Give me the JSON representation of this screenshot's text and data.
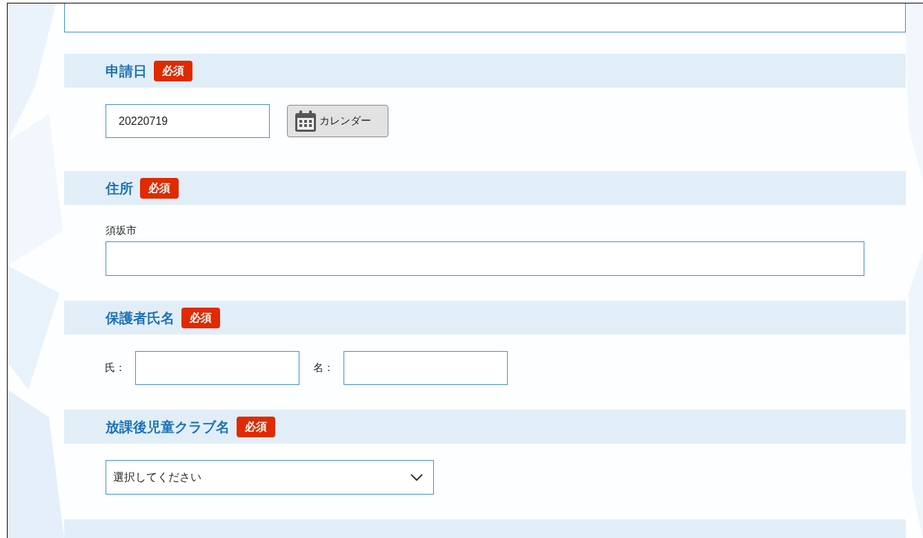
{
  "sections": [
    {
      "kind": "date",
      "title": "申請日",
      "badge": "必須",
      "value": "20220719",
      "button": "カレンダー"
    },
    {
      "kind": "address",
      "title": "住所",
      "badge": "必須",
      "prefix": "須坂市"
    },
    {
      "kind": "name_pair",
      "title": "保護者氏名",
      "badge": "必須",
      "labels": [
        "氏：",
        "名："
      ]
    },
    {
      "kind": "select",
      "title": "放課後児童クラブ名",
      "badge": "必須",
      "value": "選択してください"
    },
    {
      "kind": "none"
    }
  ]
}
